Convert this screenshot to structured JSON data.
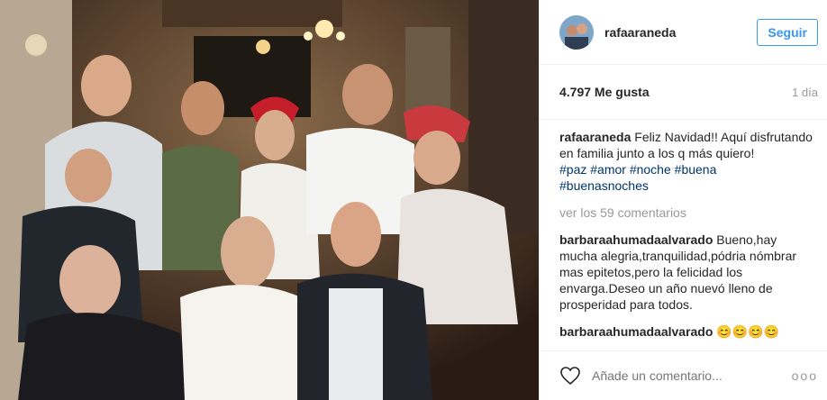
{
  "post": {
    "username": "rafaaraneda",
    "follow_label": "Seguir",
    "likes": "4.797 Me gusta",
    "time": "1 día"
  },
  "caption": {
    "user": "rafaaraneda",
    "text": "Feliz Navidad!! Aquí disfrutando en familia junto a los q más quiero!",
    "tags": [
      "#paz",
      "#amor",
      "#noche",
      "#buena",
      "#buenasnoches"
    ]
  },
  "view_comments": "ver los 59 comentarios",
  "comments": [
    {
      "user": "barbaraahumadaalvarado",
      "text": "Bueno,hay mucha alegria,tranquilidad,pódria nómbrar mas epitetos,pero la felicidad los envarga.Deseo un año nuevó lleno de prosperidad para todos."
    },
    {
      "user": "barbaraahumadaalvarado",
      "text": "😊😊😊😊"
    }
  ],
  "footer": {
    "placeholder": "Añade un comentario...",
    "more": "ooo"
  },
  "colors": {
    "accent": "#3897f0",
    "hashtag": "#003569"
  }
}
